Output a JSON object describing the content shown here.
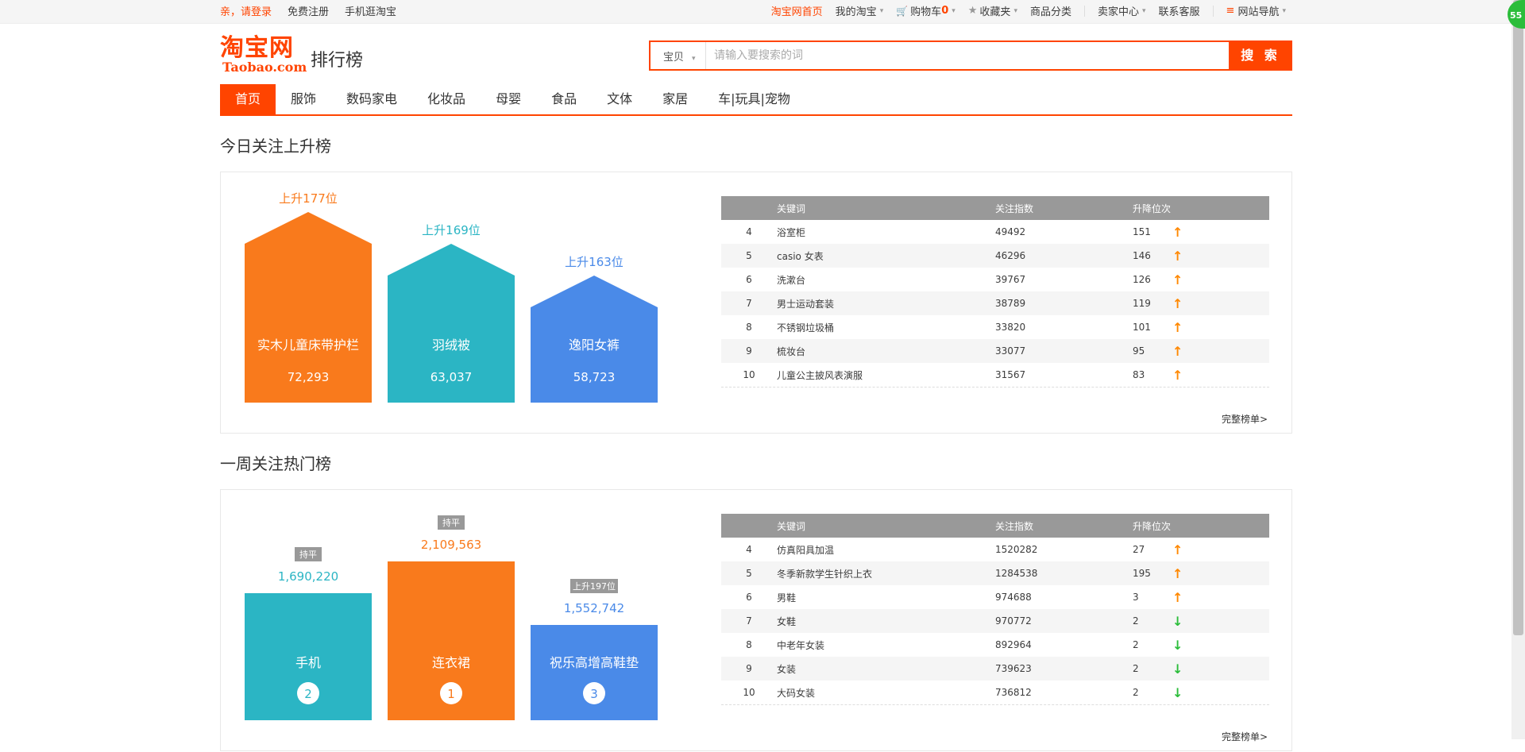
{
  "topbar": {
    "login": "亲，请登录",
    "register": "免费注册",
    "mobile": "手机逛淘宝",
    "home": "淘宝网首页",
    "my_taobao": "我的淘宝",
    "cart": "购物车",
    "cart_count": "0",
    "favorites": "收藏夹",
    "categories": "商品分类",
    "seller": "卖家中心",
    "service": "联系客服",
    "sitenav": "网站导航"
  },
  "header": {
    "logo_cn": "淘宝网",
    "logo_en": "Taobao.com",
    "subtitle": "排行榜",
    "search_scope": "宝贝",
    "search_placeholder": "请输入要搜索的词",
    "search_button": "搜 索"
  },
  "nav": {
    "tabs": [
      "首页",
      "服饰",
      "数码家电",
      "化妆品",
      "母婴",
      "食品",
      "文体",
      "家居",
      "车|玩具|宠物"
    ]
  },
  "today": {
    "title": "今日关注上升榜",
    "bars": [
      {
        "rise": "上升177位",
        "name": "实木儿童床带护栏",
        "value": "72,293",
        "color": "#f97a1c"
      },
      {
        "rise": "上升169位",
        "name": "羽绒被",
        "value": "63,037",
        "color": "#2bb5c4"
      },
      {
        "rise": "上升163位",
        "name": "逸阳女裤",
        "value": "58,723",
        "color": "#4a8ae8"
      }
    ],
    "table_headers": [
      "关键词",
      "关注指数",
      "升降位次"
    ],
    "rows": [
      {
        "rank": "4",
        "keyword": "浴室柜",
        "index": "49492",
        "change": "151",
        "dir": "up"
      },
      {
        "rank": "5",
        "keyword": "casio 女表",
        "index": "46296",
        "change": "146",
        "dir": "up"
      },
      {
        "rank": "6",
        "keyword": "洗漱台",
        "index": "39767",
        "change": "126",
        "dir": "up"
      },
      {
        "rank": "7",
        "keyword": "男士运动套装",
        "index": "38789",
        "change": "119",
        "dir": "up"
      },
      {
        "rank": "8",
        "keyword": "不锈钢垃圾桶",
        "index": "33820",
        "change": "101",
        "dir": "up"
      },
      {
        "rank": "9",
        "keyword": "梳妆台",
        "index": "33077",
        "change": "95",
        "dir": "up"
      },
      {
        "rank": "10",
        "keyword": "儿童公主披风表演服",
        "index": "31567",
        "change": "83",
        "dir": "up"
      }
    ],
    "more": "完整榜单>"
  },
  "week": {
    "title": "一周关注热门榜",
    "bars": [
      {
        "tag": "持平",
        "value": "1,690,220",
        "name": "手机",
        "rank": "2",
        "color": "#2bb5c4"
      },
      {
        "tag": "持平",
        "value": "2,109,563",
        "name": "连衣裙",
        "rank": "1",
        "color": "#f97a1c"
      },
      {
        "tag": "上升197位",
        "value": "1,552,742",
        "name": "祝乐高增高鞋垫",
        "rank": "3",
        "color": "#4a8ae8"
      }
    ],
    "table_headers": [
      "关键词",
      "关注指数",
      "升降位次"
    ],
    "rows": [
      {
        "rank": "4",
        "keyword": "仿真阳具加温",
        "index": "1520282",
        "change": "27",
        "dir": "up"
      },
      {
        "rank": "5",
        "keyword": "冬季新款学生针织上衣",
        "index": "1284538",
        "change": "195",
        "dir": "up"
      },
      {
        "rank": "6",
        "keyword": "男鞋",
        "index": "974688",
        "change": "3",
        "dir": "up"
      },
      {
        "rank": "7",
        "keyword": "女鞋",
        "index": "970772",
        "change": "2",
        "dir": "down"
      },
      {
        "rank": "8",
        "keyword": "中老年女装",
        "index": "892964",
        "change": "2",
        "dir": "down"
      },
      {
        "rank": "9",
        "keyword": "女装",
        "index": "739623",
        "change": "2",
        "dir": "down"
      },
      {
        "rank": "10",
        "keyword": "大码女装",
        "index": "736812",
        "change": "2",
        "dir": "down"
      }
    ],
    "more": "完整榜单>"
  },
  "side_badge": "55"
}
